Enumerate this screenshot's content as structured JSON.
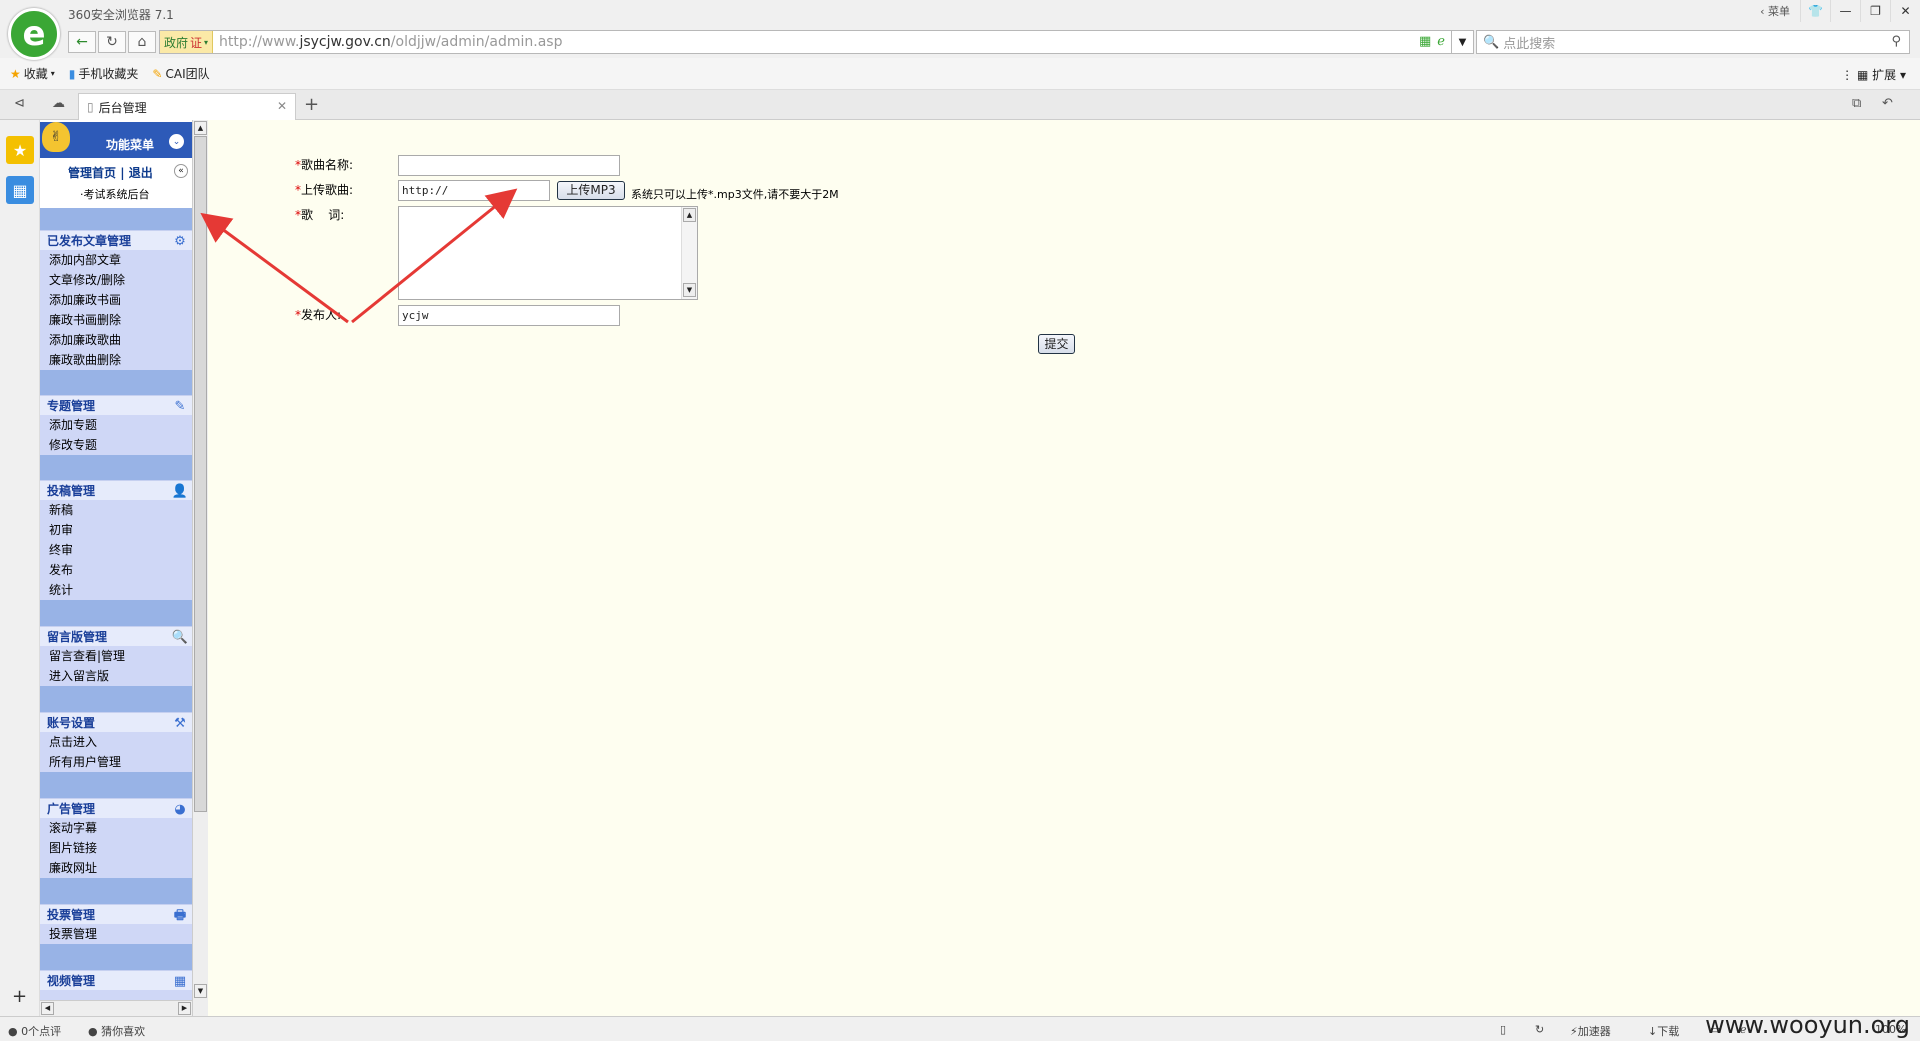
{
  "browser": {
    "title": "360安全浏览器 7.1",
    "menu_label": "菜单",
    "url_prefix": "http://www.",
    "url_domain": "jsycjw.gov.cn",
    "url_path": "/oldjjw/admin/admin.asp",
    "gov_badge": "政府",
    "gov_badge_suffix": "证",
    "search_placeholder": "点此搜索",
    "bookmarks": [
      "收藏",
      "手机收藏夹",
      "CAI团队"
    ],
    "extension_label": "扩展",
    "tab_title": "后台管理"
  },
  "menu": {
    "header": "功能菜单",
    "home_link": "管理首页",
    "separator": "|",
    "logout_link": "退出",
    "exam_link": "·考试系统后台",
    "sections": [
      {
        "title": "已发布文章管理",
        "icon": "gear-icon",
        "items": [
          "添加内部文章",
          "文章修改/删除",
          "添加廉政书画",
          "廉政书画删除",
          "添加廉政歌曲",
          "廉政歌曲删除"
        ]
      },
      {
        "title": "专题管理",
        "icon": "edit-icon",
        "items": [
          "添加专题",
          "修改专题"
        ]
      },
      {
        "title": "投稿管理",
        "icon": "user-icon",
        "items": [
          "新稿",
          "初审",
          "终审",
          "发布",
          "统计"
        ]
      },
      {
        "title": "留言版管理",
        "icon": "search-icon",
        "items": [
          "留言查看|管理",
          "进入留言版"
        ]
      },
      {
        "title": "账号设置",
        "icon": "tools-icon",
        "items": [
          "点击进入",
          "所有用户管理"
        ]
      },
      {
        "title": "广告管理",
        "icon": "globe-icon",
        "items": [
          "滚动字幕",
          "图片链接",
          "廉政网址"
        ]
      },
      {
        "title": "投票管理",
        "icon": "printer-icon",
        "items": [
          "投票管理"
        ]
      },
      {
        "title": "视频管理",
        "icon": "calendar-icon",
        "items": []
      }
    ]
  },
  "form": {
    "song_name_label": "歌曲名称:",
    "song_name_value": "",
    "upload_label": "上传歌曲:",
    "upload_value": "http://",
    "upload_button": "上传MP3",
    "upload_note": "系统只可以上传*.mp3文件,请不要大于2M",
    "lyrics_label": "歌    词:",
    "lyrics_value": "",
    "publisher_label": "发布人:",
    "publisher_value": "ycjw",
    "submit_button": "提交",
    "required_mark": "*"
  },
  "status": {
    "comments": "0个点评",
    "guess": "猜你喜欢",
    "accelerator": "加速器",
    "download": "下载",
    "zoom": "100%",
    "watermark": "www.wooyun.org"
  },
  "colors": {
    "menu_header": "#2d5ab8",
    "menu_bg": "#cfd7f6",
    "menu_band": "#98b3e6",
    "main_bg": "#fefef0",
    "arrow": "#e53935"
  }
}
